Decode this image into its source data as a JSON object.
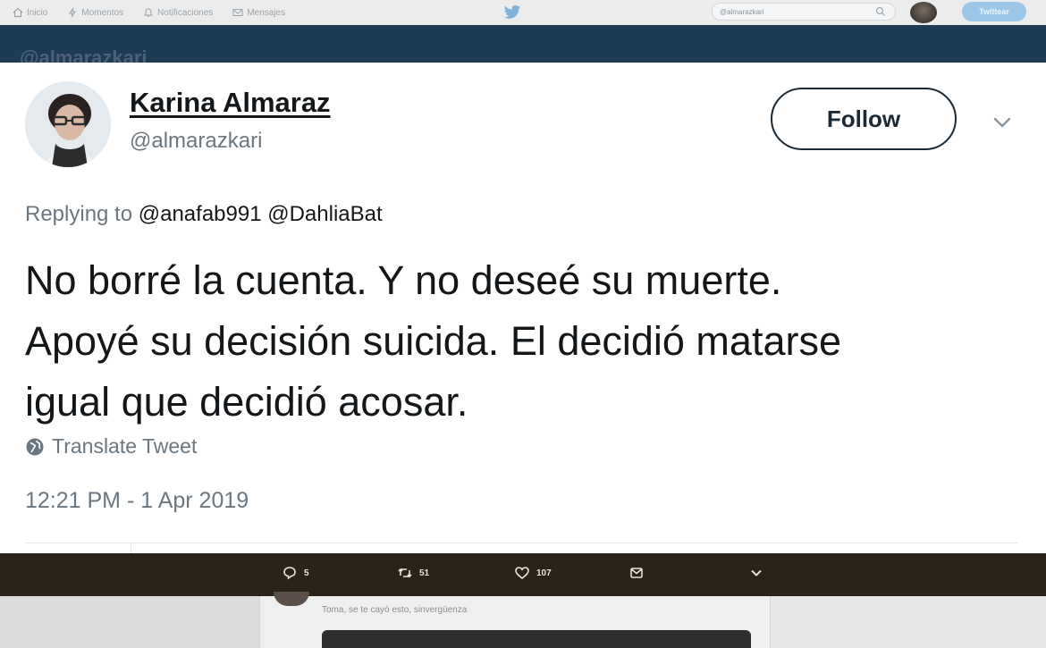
{
  "nav": {
    "items": [
      {
        "label": "Inicio",
        "icon": "home-icon"
      },
      {
        "label": "Momentos",
        "icon": "lightning-icon"
      },
      {
        "label": "Notificaciones",
        "icon": "bell-icon"
      },
      {
        "label": "Mensajes",
        "icon": "mail-icon"
      }
    ],
    "search_value": "@almarazkari",
    "tweet_button": "Twittear"
  },
  "banner": {
    "handle": "@almarazkari"
  },
  "tweet": {
    "author_name": "Karina Almaraz",
    "author_handle": "@almarazkari",
    "follow_label": "Follow",
    "replying_prefix": "Replying to",
    "replying_mentions": "@anafab991 @DahliaBat",
    "text_lines": [
      "No borré la cuenta. Y no deseé su muerte.",
      "Apoyé su decisión suicida. El decidió matarse",
      "igual que decidió acosar."
    ],
    "translate_label": "Translate Tweet",
    "timestamp": "12:21 PM - 1 Apr 2019"
  },
  "actions": {
    "replies": "5",
    "retweets": "51",
    "likes": "107"
  },
  "reply_preview": {
    "text": "Toma, se te cayó esto, sinvergüenza"
  },
  "colors": {
    "banner": "#1e3b55",
    "action_bar": "#2b2218",
    "text_primary": "#14171a",
    "text_secondary": "#6b7780"
  }
}
